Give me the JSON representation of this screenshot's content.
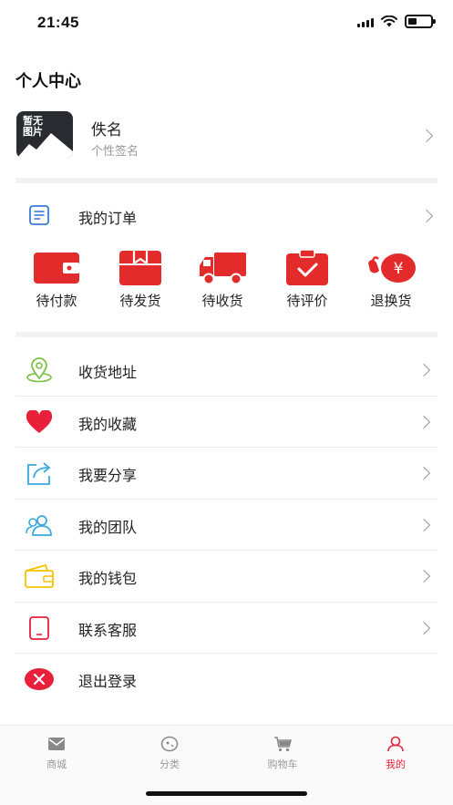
{
  "status_bar": {
    "time": "21:45",
    "battery_level": 0.4
  },
  "page_title": "个人中心",
  "profile": {
    "avatar_text": "暂无图片",
    "name": "佚名",
    "signature": "个性签名"
  },
  "orders": {
    "label": "我的订单",
    "statuses": [
      {
        "label": "待付款",
        "icon": "wallet-icon"
      },
      {
        "label": "待发货",
        "icon": "package-icon"
      },
      {
        "label": "待收货",
        "icon": "truck-icon"
      },
      {
        "label": "待评价",
        "icon": "review-icon"
      },
      {
        "label": "退换货",
        "icon": "refund-icon"
      }
    ]
  },
  "menu": [
    {
      "label": "收货地址",
      "icon": "location-pin-icon"
    },
    {
      "label": "我的收藏",
      "icon": "heart-icon"
    },
    {
      "label": "我要分享",
      "icon": "share-icon"
    },
    {
      "label": "我的团队",
      "icon": "team-icon"
    },
    {
      "label": "我的钱包",
      "icon": "wallet-icon"
    },
    {
      "label": "联系客服",
      "icon": "tablet-icon"
    },
    {
      "label": "退出登录",
      "icon": "logout-icon"
    }
  ],
  "tabbar": {
    "active": "我的",
    "tabs": [
      {
        "label": "商城",
        "icon": "mail-icon"
      },
      {
        "label": "分类",
        "icon": "category-icon"
      },
      {
        "label": "购物车",
        "icon": "cart-icon"
      },
      {
        "label": "我的",
        "icon": "user-icon"
      }
    ]
  },
  "colors": {
    "accent": "#e8203a",
    "order_red": "#e42b2b",
    "text": "#222222",
    "muted": "#999999"
  }
}
